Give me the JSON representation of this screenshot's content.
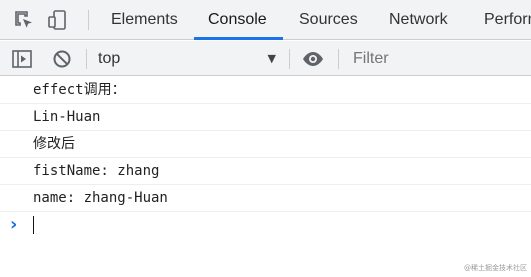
{
  "tabs": {
    "items": [
      {
        "label": "Elements",
        "icon": null
      },
      {
        "label": "Console",
        "active": true
      },
      {
        "label": "Sources"
      },
      {
        "label": "Network"
      },
      {
        "label": "Perforn"
      }
    ],
    "icons": [
      "inspect-element-icon",
      "device-toolbar-icon"
    ],
    "accent_color": "#1a73e8"
  },
  "toolbar": {
    "context": "top",
    "filter_placeholder": "Filter",
    "icons": [
      "sidebar-toggle-icon",
      "clear-console-icon",
      "context-dropdown-arrow-icon",
      "live-expression-eye-icon"
    ]
  },
  "console": {
    "lines": [
      "effect调用：",
      "Lin-Huan",
      "修改后",
      "fistName: zhang",
      "name: zhang-Huan"
    ],
    "prompt": "›"
  },
  "watermark": "@稀土掘金技术社区"
}
